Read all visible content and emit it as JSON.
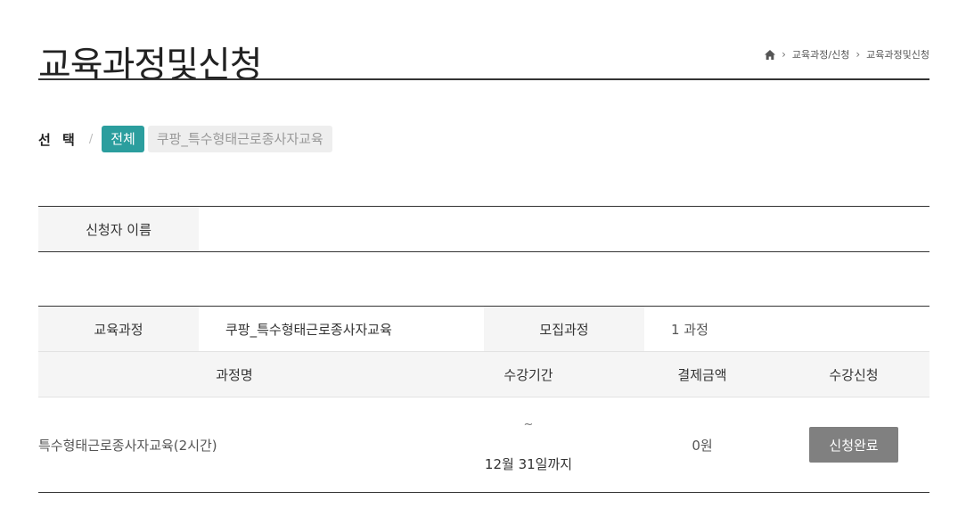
{
  "header": {
    "title": "교육과정및신청",
    "breadcrumb": {
      "home_icon": "home-icon",
      "items": [
        "교육과정/신청",
        "교육과정및신청"
      ]
    }
  },
  "filter": {
    "label": "선 택",
    "separator": "/",
    "chips": [
      {
        "label": "전체",
        "active": true
      },
      {
        "label": "쿠팡_특수형태근로종사자교육",
        "active": false
      }
    ]
  },
  "applicant": {
    "label": "신청자 이름",
    "value": ""
  },
  "course": {
    "info": {
      "course_label": "교육과정",
      "course_value": "쿠팡_특수형태근로종사자교육",
      "recruit_label": "모집과정",
      "recruit_value": "1 과정"
    },
    "columns": [
      "과정명",
      "수강기간",
      "결제금액",
      "수강신청"
    ],
    "rows": [
      {
        "name": "특수형태근로종사자교육(2시간)",
        "period_sep": "~",
        "period_end": "12월 31일까지",
        "price": "0원",
        "action": "신청완료"
      }
    ]
  },
  "colors": {
    "accent": "#2b9e9e",
    "rule": "#333333",
    "header_bg": "#f5f5f5",
    "button_done": "#808080"
  }
}
